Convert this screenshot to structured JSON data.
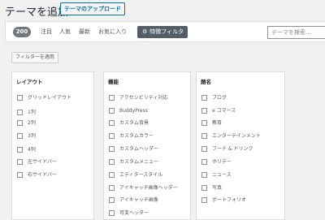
{
  "header": {
    "title": "テーマを追加",
    "upload_button": "テーマのアップロード"
  },
  "filterbar": {
    "count": "200",
    "tabs": [
      "注目",
      "人気",
      "最新",
      "お気に入り"
    ],
    "feature_filter_label": "特徴フィルター",
    "search_placeholder": "テーマを検索..."
  },
  "apply_button": "フィルターを適用",
  "columns": [
    {
      "title": "レイアウト",
      "options": [
        "グリッドレイアウト",
        "1列",
        "2列",
        "3列",
        "4列",
        "左サイドバー",
        "右サイドバー"
      ]
    },
    {
      "title": "機能",
      "options": [
        "アクセシビリティ対応",
        "BuddyPress",
        "カスタム背景",
        "カスタムカラー",
        "カスタムヘッダー",
        "カスタムメニュー",
        "エディタースタイル",
        "アイキャッチ画像ヘッダー",
        "アイキャッチ画像",
        "可変ヘッダー"
      ]
    },
    {
      "title": "題名",
      "options": [
        "ブログ",
        "e コマース",
        "教育",
        "エンターテインメント",
        "フード & ドリンク",
        "ホリデー",
        "ニュース",
        "写真",
        "ポートフォリオ"
      ]
    }
  ]
}
